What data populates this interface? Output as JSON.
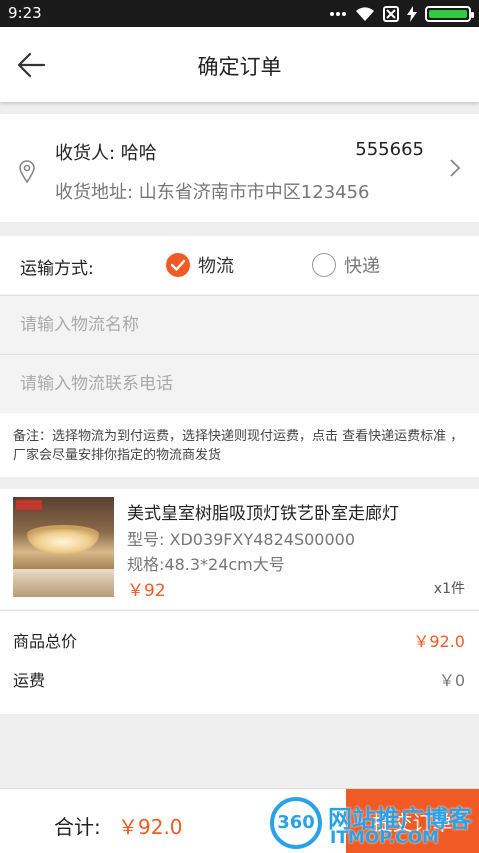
{
  "status_bar": {
    "time": "9:23",
    "battery_level": 1.0
  },
  "header": {
    "title": "确定订单"
  },
  "address": {
    "receiver_label": "收货人: ",
    "receiver_name": "哈哈",
    "phone": "555665",
    "detail": "收货地址: 山东省济南市市中区123456"
  },
  "shipping": {
    "label": "运输方式:",
    "options": [
      {
        "label": "物流",
        "selected": true
      },
      {
        "label": "快递",
        "selected": false
      }
    ],
    "logistics_name_placeholder": "请输入物流名称",
    "logistics_phone_placeholder": "请输入物流联系电话",
    "note": "备注：选择物流为到付运费，选择快递则现付运费，点击 查看快递运费标准 ，厂家会尽量安排你指定的物流商发货"
  },
  "product": {
    "name": "美式皇室树脂吸顶灯铁艺卧室走廊灯",
    "model": "型号: XD039FXY4824S00000",
    "spec": "规格:48.3*24cm大号",
    "price": "￥92",
    "qty": "x1件"
  },
  "summary": {
    "goods_total_label": "商品总价",
    "goods_total_value": "￥92.0",
    "freight_label": "运费",
    "freight_value": "￥0"
  },
  "bottom_bar": {
    "total_label": "合计:",
    "total_value": "￥92.0",
    "submit_label": "提交订单"
  },
  "watermark": {
    "logo": "360",
    "text": "网站推广博客",
    "sub": "ITMOP.COM"
  },
  "colors": {
    "accent": "#f05a24",
    "watermark": "#2aa2e8"
  }
}
